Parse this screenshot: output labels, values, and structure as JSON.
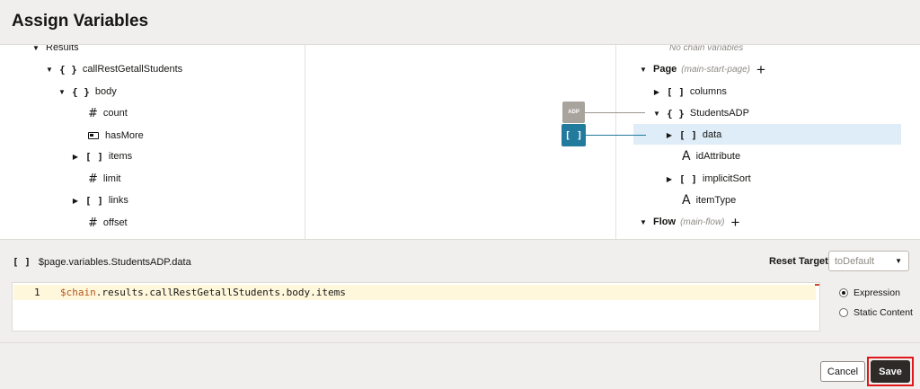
{
  "dialog": {
    "title": "Assign Variables"
  },
  "source_tree": {
    "results": "Results",
    "call_rest": "callRestGetallStudents",
    "body": "body",
    "count": "count",
    "has_more": "hasMore",
    "items": "items",
    "limit": "limit",
    "links": "links",
    "offset": "offset"
  },
  "icons": {
    "object": "{ }",
    "array": "[ ]",
    "number": "#",
    "string": "A",
    "caret_down": "▼",
    "caret_right": "▶",
    "plus": "+"
  },
  "mapping": {
    "adp_badge": "ADP",
    "array_badge": "[ ]"
  },
  "target_tree": {
    "no_chain": "No chain variables",
    "page_label": "Page",
    "page_sub": "(main-start-page)",
    "columns": "columns",
    "students_adp": "StudentsADP",
    "data": "data",
    "id_attribute": "idAttribute",
    "implicit_sort": "implicitSort",
    "item_type": "itemType",
    "flow_label": "Flow",
    "flow_sub": "(main-flow)"
  },
  "target": {
    "path": "$page.variables.StudentsADP.data",
    "reset_label": "Reset Target",
    "reset_value": "toDefault"
  },
  "editor": {
    "line_number": "1",
    "code_var": "$chain",
    "code_rest": ".results.callRestGetallStudents.body.items"
  },
  "mode": {
    "expression": "Expression",
    "static": "Static Content",
    "selected": "Expression"
  },
  "footer": {
    "cancel": "Cancel",
    "save": "Save"
  },
  "colors": {
    "accent": "#227a9c",
    "selection": "#deedf7",
    "save_highlight": "#e0161b",
    "save_button": "#2d2a27"
  }
}
